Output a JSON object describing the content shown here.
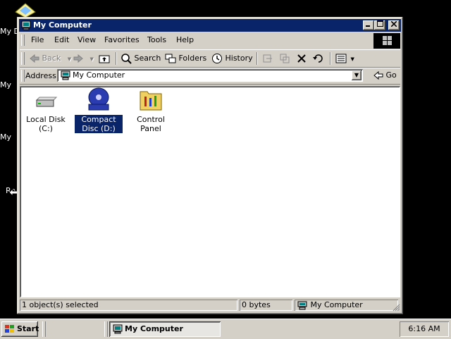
{
  "desktop": {
    "icons": [
      {
        "label": "My D"
      },
      {
        "label": "My"
      },
      {
        "label": "My"
      },
      {
        "label": "Re"
      }
    ]
  },
  "window": {
    "title": "My Computer",
    "menu": [
      "File",
      "Edit",
      "View",
      "Favorites",
      "Tools",
      "Help"
    ],
    "toolbar": {
      "back": "Back",
      "search": "Search",
      "folders": "Folders",
      "history": "History"
    },
    "address": {
      "label": "Address",
      "value": "My Computer",
      "go": "Go"
    },
    "items": [
      {
        "label": "Local Disk (C:)",
        "icon": "hard-drive-icon",
        "selected": false
      },
      {
        "label": "Compact Disc (D:)",
        "icon": "cd-drive-icon",
        "selected": true
      },
      {
        "label": "Control Panel",
        "icon": "control-panel-icon",
        "selected": false
      }
    ],
    "status": {
      "selection": "1 object(s) selected",
      "size": "0 bytes",
      "zone": "My Computer"
    }
  },
  "taskbar": {
    "start": "Start",
    "task": "My Computer",
    "clock": "6:16 AM"
  },
  "colors": {
    "title_active": "#0a246a",
    "face": "#d4d0c8",
    "desktop": "#000000",
    "selection": "#0a246a"
  }
}
